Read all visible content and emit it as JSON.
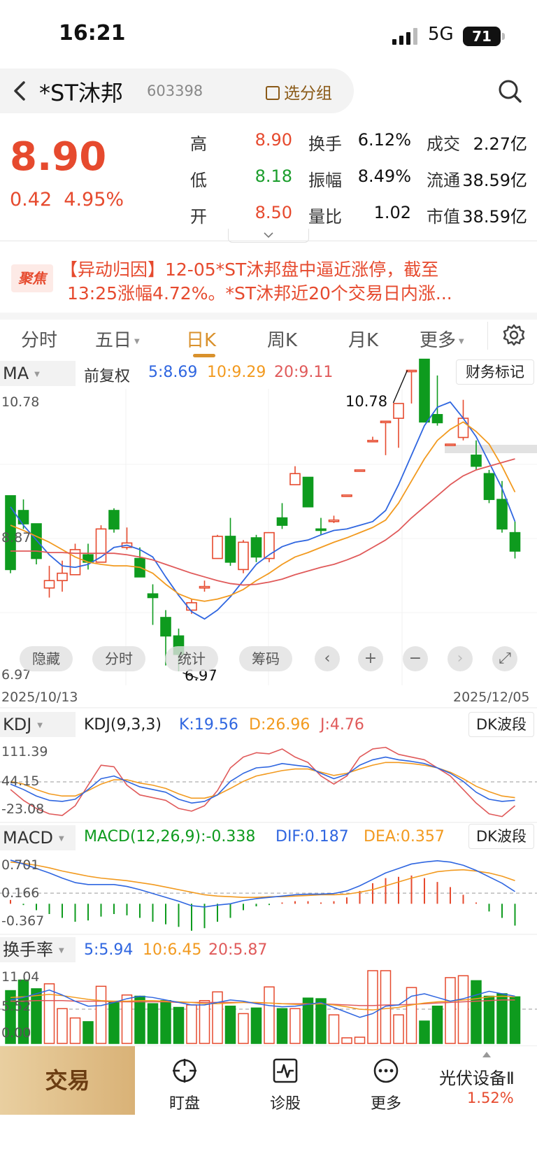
{
  "status_bar": {
    "time": "16:21",
    "network": "5G",
    "battery": "71"
  },
  "header": {
    "back_icon": "chevron-left-icon",
    "name": "*ST沐邦",
    "code": "603398",
    "group_label": "选分组",
    "search_icon": "search-icon"
  },
  "quote": {
    "price": "8.90",
    "change": "0.42",
    "change_pct": "4.95%",
    "rows": [
      [
        {
          "label": "高",
          "value": "8.90",
          "tone": "red"
        },
        {
          "label": "换手",
          "value": "6.12%"
        },
        {
          "label": "成交",
          "value": "2.27亿"
        }
      ],
      [
        {
          "label": "低",
          "value": "8.18",
          "tone": "green"
        },
        {
          "label": "振幅",
          "value": "8.49%"
        },
        {
          "label": "流通",
          "value": "38.59亿"
        }
      ],
      [
        {
          "label": "开",
          "value": "8.50",
          "tone": "red"
        },
        {
          "label": "量比",
          "value": "1.02"
        },
        {
          "label": "市值",
          "value": "38.59亿"
        }
      ]
    ]
  },
  "news": {
    "badge": "聚焦",
    "line1": "【异动归因】12-05*ST沐邦盘中逼近涨停，截至",
    "line2": "13:25涨幅4.72%。*ST沐邦近20个交易日内涨..."
  },
  "tabs": {
    "items": [
      "分时",
      "五日",
      "日K",
      "周K",
      "月K",
      "更多"
    ],
    "active": "日K",
    "settings_icon": "gear-icon"
  },
  "kline": {
    "indicator": "MA",
    "adjust": "前复权",
    "ma5_label": "5:8.69",
    "ma10_label": "10:9.29",
    "ma20_label": "20:9.11",
    "finance_button": "财务标记",
    "y_top": "10.78",
    "y_mid": "8.87",
    "y_bottom": "6.97",
    "high_mark": "10.78",
    "low_mark": "6.97",
    "date_start": "2025/10/13",
    "date_end": "2025/12/05",
    "toolbar": {
      "hide": "隐藏",
      "intraday": "分时",
      "stats": "统计",
      "chips": "筹码"
    },
    "colors": {
      "up": "#e64a2e",
      "down": "#0e9b1e",
      "ma5": "#2f66e0",
      "ma10": "#f29a1f",
      "ma20": "#e05a5a"
    }
  },
  "kdj": {
    "indicator": "KDJ",
    "params": "KDJ(9,3,3)",
    "k": "K:19.56",
    "d": "D:26.96",
    "j": "J:4.76",
    "button": "DK波段",
    "y_top": "111.39",
    "y_mid": "44.15",
    "y_bottom": "-23.08"
  },
  "macd": {
    "indicator": "MACD",
    "params": "MACD(12,26,9):-0.338",
    "dif": "DIF:0.187",
    "dea": "DEA:0.357",
    "button": "DK波段",
    "y_top": "0.701",
    "y_mid": "0.166",
    "y_bottom": "-0.367"
  },
  "turnover": {
    "indicator": "换手率",
    "ma5": "5:5.94",
    "ma10": "10:6.45",
    "ma20": "20:5.87",
    "y_top": "11.04",
    "y_mid": "5.52",
    "y_bottom": "0.00"
  },
  "chart_data": {
    "type": "candlestick",
    "x": [
      "2025/10/13",
      "",
      "",
      "",
      "",
      "",
      "",
      "",
      "",
      "",
      "",
      "",
      "",
      "",
      "",
      "",
      "",
      "",
      "",
      "",
      "",
      "",
      "",
      "",
      "",
      "",
      "",
      "",
      "",
      "",
      "",
      "",
      "",
      "",
      "",
      "",
      "",
      "",
      "",
      "2025/12/05"
    ],
    "y_range": [
      6.97,
      10.78
    ],
    "candles": [
      [
        9.35,
        8.35,
        9.35,
        8.3
      ],
      [
        9.15,
        8.97,
        9.3,
        8.9
      ],
      [
        8.97,
        8.5,
        8.97,
        8.42
      ],
      [
        8.1,
        8.2,
        8.4,
        7.97
      ],
      [
        8.2,
        8.3,
        8.47,
        8.05
      ],
      [
        8.28,
        8.62,
        8.7,
        8.28
      ],
      [
        8.55,
        8.45,
        8.7,
        8.35
      ],
      [
        8.45,
        8.9,
        8.95,
        8.45
      ],
      [
        9.15,
        8.9,
        9.18,
        8.85
      ],
      [
        8.65,
        8.71,
        8.92,
        8.62
      ],
      [
        8.5,
        8.25,
        8.65,
        8.25
      ],
      [
        8.02,
        7.97,
        8.15,
        7.6
      ],
      [
        7.7,
        7.45,
        7.8,
        7.05
      ],
      [
        7.45,
        7.2,
        7.55,
        6.97
      ],
      [
        7.8,
        7.9,
        7.95,
        7.75
      ],
      [
        8.1,
        8.12,
        8.2,
        8.05
      ],
      [
        8.5,
        8.8,
        8.82,
        8.5
      ],
      [
        8.8,
        8.45,
        9.05,
        8.4
      ],
      [
        8.35,
        8.72,
        8.75,
        8.3
      ],
      [
        8.78,
        8.52,
        8.82,
        8.45
      ],
      [
        8.5,
        8.85,
        8.85,
        8.45
      ],
      [
        9.05,
        8.95,
        9.25,
        8.9
      ],
      [
        9.5,
        9.65,
        9.75,
        9.5
      ],
      [
        9.6,
        9.2,
        9.6,
        9.2
      ],
      [
        8.9,
        8.88,
        9.05,
        8.82
      ],
      [
        9.0,
        9.02,
        9.08,
        8.98
      ],
      [
        9.36,
        9.36,
        9.36,
        9.36
      ],
      [
        9.7,
        9.7,
        9.7,
        9.7
      ],
      [
        10.1,
        10.1,
        10.15,
        10.1
      ],
      [
        10.35,
        10.36,
        10.36,
        9.9
      ],
      [
        10.4,
        10.6,
        10.6,
        10.0
      ],
      [
        11.05,
        11.05,
        11.05,
        10.6
      ],
      [
        11.2,
        10.35,
        11.2,
        10.35
      ],
      [
        10.45,
        10.34,
        10.98,
        10.3
      ],
      [
        10.05,
        10.05,
        10.05,
        10.05
      ],
      [
        10.14,
        10.4,
        10.65,
        10.1
      ],
      [
        9.9,
        9.75,
        10.1,
        9.7
      ],
      [
        9.65,
        9.3,
        9.7,
        9.25
      ],
      [
        9.3,
        8.9,
        9.55,
        8.85
      ],
      [
        8.85,
        8.6,
        9.0,
        8.5
      ]
    ],
    "ma5": [
      9.2,
      8.95,
      8.75,
      8.55,
      8.4,
      8.38,
      8.42,
      8.52,
      8.65,
      8.68,
      8.62,
      8.52,
      8.25,
      8.0,
      7.78,
      7.68,
      7.8,
      7.98,
      8.2,
      8.42,
      8.55,
      8.66,
      8.72,
      8.75,
      8.82,
      8.88,
      8.9,
      8.95,
      9.0,
      9.15,
      9.5,
      9.9,
      10.3,
      10.55,
      10.62,
      10.4,
      10.15,
      9.8,
      9.45,
      9.0
    ],
    "ma10": [
      8.95,
      8.88,
      8.8,
      8.72,
      8.62,
      8.52,
      8.45,
      8.42,
      8.4,
      8.4,
      8.38,
      8.3,
      8.15,
      8.02,
      7.95,
      7.92,
      7.95,
      8.0,
      8.08,
      8.2,
      8.3,
      8.42,
      8.52,
      8.58,
      8.65,
      8.72,
      8.78,
      8.85,
      8.92,
      9.02,
      9.25,
      9.55,
      9.85,
      10.1,
      10.25,
      10.35,
      10.22,
      10.05,
      9.75,
      9.4
    ],
    "ma20": [
      8.6,
      8.6,
      8.6,
      8.58,
      8.58,
      8.57,
      8.57,
      8.57,
      8.57,
      8.55,
      8.52,
      8.48,
      8.42,
      8.36,
      8.3,
      8.25,
      8.2,
      8.16,
      8.14,
      8.15,
      8.18,
      8.22,
      8.28,
      8.33,
      8.38,
      8.42,
      8.48,
      8.55,
      8.65,
      8.75,
      8.88,
      9.05,
      9.2,
      9.35,
      9.5,
      9.62,
      9.7,
      9.75,
      9.8,
      9.85
    ],
    "kdj_range": [
      -23.08,
      111.39
    ],
    "kdj_k": [
      40,
      30,
      18,
      10,
      8,
      12,
      30,
      50,
      55,
      45,
      35,
      30,
      25,
      12,
      5,
      8,
      20,
      45,
      60,
      70,
      72,
      78,
      75,
      72,
      60,
      50,
      58,
      75,
      85,
      90,
      85,
      82,
      78,
      70,
      60,
      45,
      25,
      12,
      8,
      10
    ],
    "kdj_d": [
      45,
      40,
      30,
      22,
      18,
      18,
      28,
      40,
      48,
      48,
      42,
      38,
      32,
      22,
      14,
      14,
      20,
      32,
      45,
      55,
      60,
      65,
      68,
      68,
      62,
      56,
      60,
      68,
      75,
      80,
      80,
      78,
      75,
      70,
      62,
      50,
      36,
      26,
      18,
      15
    ],
    "kdj_j": [
      30,
      10,
      -5,
      -15,
      -18,
      0,
      38,
      75,
      72,
      38,
      20,
      15,
      10,
      -5,
      -10,
      0,
      28,
      70,
      90,
      98,
      96,
      105,
      90,
      80,
      55,
      40,
      55,
      90,
      105,
      108,
      95,
      90,
      85,
      70,
      55,
      30,
      5,
      -15,
      -20,
      0
    ],
    "macd_range": [
      -0.367,
      0.701
    ],
    "dif": [
      0.68,
      0.62,
      0.55,
      0.48,
      0.4,
      0.33,
      0.3,
      0.3,
      0.3,
      0.27,
      0.22,
      0.16,
      0.1,
      0.04,
      -0.03,
      -0.05,
      -0.02,
      0.0,
      0.05,
      0.08,
      0.1,
      0.12,
      0.14,
      0.15,
      0.15,
      0.16,
      0.2,
      0.28,
      0.38,
      0.48,
      0.55,
      0.62,
      0.65,
      0.67,
      0.65,
      0.6,
      0.52,
      0.42,
      0.32,
      0.19
    ],
    "dea": [
      0.65,
      0.63,
      0.6,
      0.56,
      0.51,
      0.47,
      0.43,
      0.4,
      0.38,
      0.36,
      0.33,
      0.3,
      0.26,
      0.22,
      0.18,
      0.14,
      0.12,
      0.11,
      0.1,
      0.1,
      0.11,
      0.11,
      0.12,
      0.13,
      0.14,
      0.14,
      0.15,
      0.18,
      0.22,
      0.28,
      0.34,
      0.4,
      0.45,
      0.5,
      0.52,
      0.53,
      0.51,
      0.48,
      0.43,
      0.36
    ],
    "macd_hist": [
      0.06,
      -0.02,
      -0.1,
      -0.16,
      -0.22,
      -0.28,
      -0.26,
      -0.2,
      -0.16,
      -0.18,
      -0.22,
      -0.28,
      -0.32,
      -0.36,
      -0.42,
      -0.38,
      -0.28,
      -0.22,
      -0.1,
      -0.04,
      -0.02,
      0.02,
      0.04,
      0.04,
      0.02,
      0.04,
      0.1,
      0.2,
      0.32,
      0.4,
      0.42,
      0.44,
      0.4,
      0.34,
      0.26,
      0.14,
      0.02,
      -0.12,
      -0.22,
      -0.34
    ],
    "turnover_range": [
      0.0,
      11.04
    ],
    "turnover": [
      8.5,
      10.2,
      8.8,
      9.6,
      5.6,
      4.1,
      3.5,
      9.2,
      6.8,
      7.8,
      7.6,
      6.4,
      6.9,
      5.8,
      6.2,
      6.9,
      8.3,
      6.0,
      4.8,
      5.7,
      9.1,
      5.6,
      5.6,
      7.3,
      7.2,
      4.6,
      0.9,
      1.0,
      12.7,
      12.2,
      4.6,
      9.0,
      3.6,
      6.0,
      10.6,
      10.9,
      10.1,
      7.6,
      8.0,
      7.5
    ],
    "to_ma5": [
      7.0,
      7.4,
      8.0,
      8.6,
      7.8,
      6.8,
      6.0,
      6.1,
      6.6,
      7.2,
      7.6,
      7.4,
      7.0,
      6.6,
      6.2,
      6.2,
      6.6,
      7.0,
      6.8,
      6.4,
      6.1,
      5.9,
      6.0,
      6.3,
      6.6,
      5.8,
      5.0,
      4.2,
      4.8,
      6.0,
      6.2,
      7.6,
      8.0,
      7.4,
      6.8,
      7.2,
      7.8,
      8.4,
      8.0,
      7.6
    ],
    "to_ma10": [
      7.4,
      7.5,
      7.7,
      7.9,
      7.7,
      7.4,
      7.1,
      6.9,
      6.8,
      6.8,
      6.9,
      6.9,
      6.8,
      6.7,
      6.6,
      6.4,
      6.4,
      6.5,
      6.6,
      6.6,
      6.5,
      6.4,
      6.3,
      6.3,
      6.4,
      6.2,
      5.9,
      5.5,
      5.4,
      5.6,
      5.8,
      6.2,
      6.5,
      6.7,
      6.8,
      7.0,
      7.2,
      7.5,
      7.6,
      7.5
    ],
    "to_ma20": [
      6.8,
      6.8,
      6.9,
      6.9,
      6.9,
      6.8,
      6.8,
      6.8,
      6.7,
      6.7,
      6.7,
      6.7,
      6.7,
      6.6,
      6.6,
      6.6,
      6.6,
      6.6,
      6.6,
      6.5,
      6.5,
      6.4,
      6.4,
      6.4,
      6.4,
      6.3,
      6.2,
      6.1,
      6.1,
      6.2,
      6.2,
      6.3,
      6.4,
      6.5,
      6.6,
      6.7,
      6.8,
      6.9,
      7.0,
      7.0
    ]
  },
  "bottom_nav": {
    "trade": "交易",
    "watch": "盯盘",
    "diagnose": "诊股",
    "more": "更多",
    "sector_name": "光伏设备Ⅱ",
    "sector_pct": "1.52%"
  }
}
